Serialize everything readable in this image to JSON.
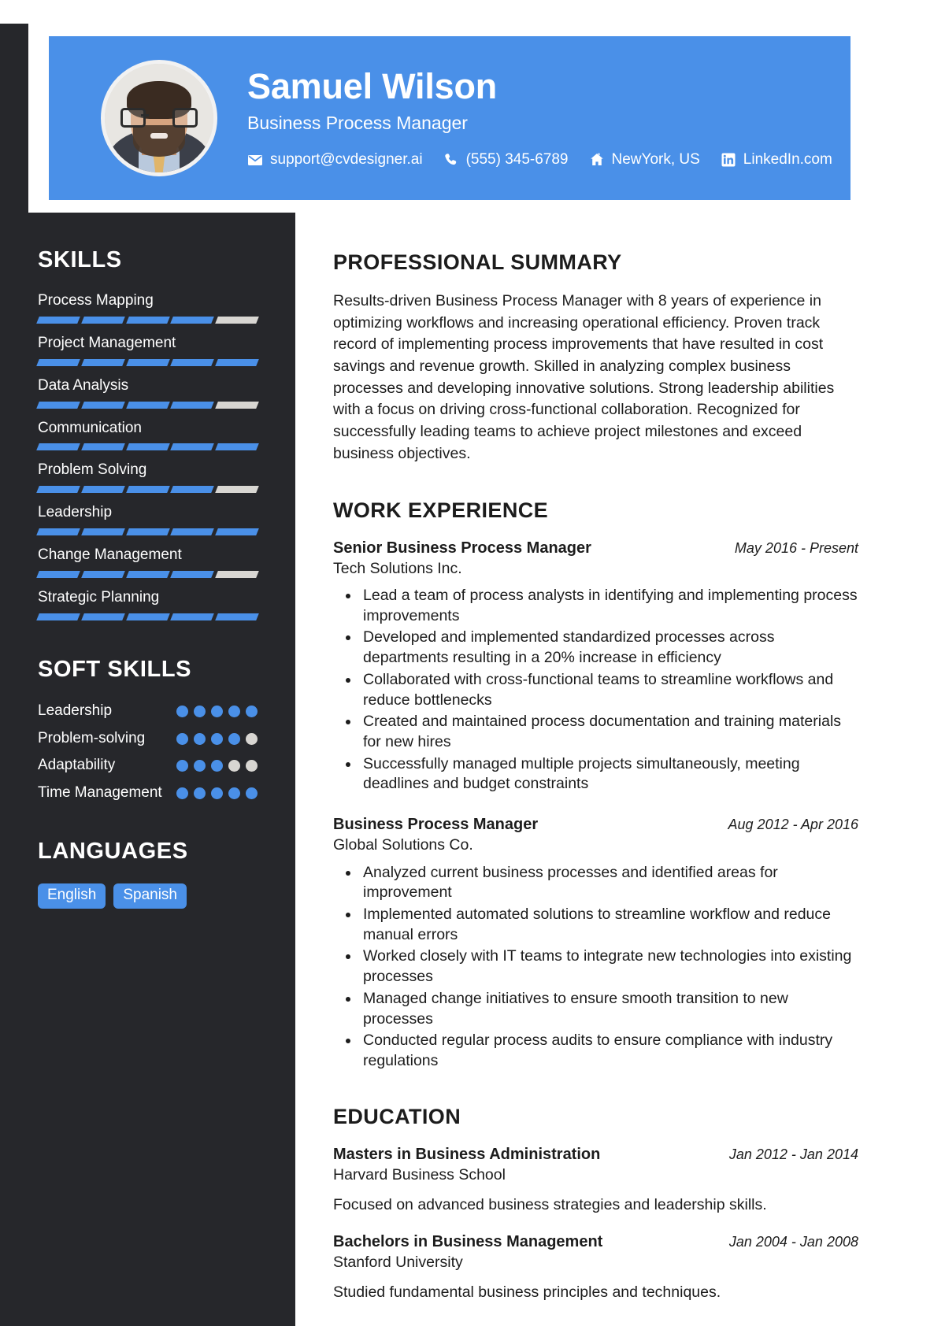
{
  "theme": {
    "accent": "#4a90e8",
    "sidebar_bg": "#26272b",
    "page_bg": "#ffffff",
    "segment_off": "#d8d6d2"
  },
  "header": {
    "name": "Samuel Wilson",
    "role": "Business Process Manager",
    "avatar_alt": "profile-photo",
    "contacts": [
      {
        "icon": "envelope-icon",
        "text": "support@cvdesigner.ai"
      },
      {
        "icon": "phone-icon",
        "text": "(555) 345-6789"
      },
      {
        "icon": "home-icon",
        "text": "NewYork, US"
      },
      {
        "icon": "linkedin-icon",
        "text": "LinkedIn.com"
      }
    ]
  },
  "sidebar": {
    "skills_title": "SKILLS",
    "skills_total_segments": 5,
    "skills": [
      {
        "name": "Process Mapping",
        "level": 4
      },
      {
        "name": "Project Management",
        "level": 5
      },
      {
        "name": "Data Analysis",
        "level": 4
      },
      {
        "name": "Communication",
        "level": 5
      },
      {
        "name": "Problem Solving",
        "level": 4
      },
      {
        "name": "Leadership",
        "level": 5
      },
      {
        "name": "Change Management",
        "level": 4
      },
      {
        "name": "Strategic Planning",
        "level": 5
      }
    ],
    "soft_skills_title": "SOFT SKILLS",
    "soft_skills_total_dots": 5,
    "soft_skills": [
      {
        "name": "Leadership",
        "level": 5
      },
      {
        "name": "Problem-solving",
        "level": 4
      },
      {
        "name": "Adaptability",
        "level": 3
      },
      {
        "name": "Time Management",
        "level": 5
      }
    ],
    "languages_title": "LANGUAGES",
    "languages": [
      "English",
      "Spanish"
    ]
  },
  "main": {
    "summary_title": "PROFESSIONAL SUMMARY",
    "summary_text": "Results-driven Business Process Manager with 8 years of experience in optimizing workflows and increasing operational efficiency. Proven track record of implementing process improvements that have resulted in cost savings and revenue growth. Skilled in analyzing complex business processes and developing innovative solutions. Strong leadership abilities with a focus on driving cross-functional collaboration. Recognized for successfully leading teams to achieve project milestones and exceed business objectives.",
    "experience_title": "WORK EXPERIENCE",
    "experience": [
      {
        "title": "Senior Business Process Manager",
        "date": "May 2016 - Present",
        "company": "Tech Solutions Inc.",
        "bullets": [
          "Lead a team of process analysts in identifying and implementing process improvements",
          "Developed and implemented standardized processes across departments resulting in a 20% increase in efficiency",
          "Collaborated with cross-functional teams to streamline workflows and reduce bottlenecks",
          "Created and maintained process documentation and training materials for new hires",
          "Successfully managed multiple projects simultaneously, meeting deadlines and budget constraints"
        ]
      },
      {
        "title": "Business Process Manager",
        "date": "Aug 2012 - Apr 2016",
        "company": "Global Solutions Co.",
        "bullets": [
          "Analyzed current business processes and identified areas for improvement",
          "Implemented automated solutions to streamline workflow and reduce manual errors",
          "Worked closely with IT teams to integrate new technologies into existing processes",
          "Managed change initiatives to ensure smooth transition to new processes",
          "Conducted regular process audits to ensure compliance with industry regulations"
        ]
      }
    ],
    "education_title": "EDUCATION",
    "education": [
      {
        "degree": "Masters in Business Administration",
        "date": "Jan 2012 - Jan 2014",
        "school": "Harvard Business School",
        "description": "Focused on advanced business strategies and leadership skills."
      },
      {
        "degree": "Bachelors in Business Management",
        "date": "Jan 2004 - Jan 2008",
        "school": "Stanford University",
        "description": "Studied fundamental business principles and techniques."
      }
    ]
  }
}
